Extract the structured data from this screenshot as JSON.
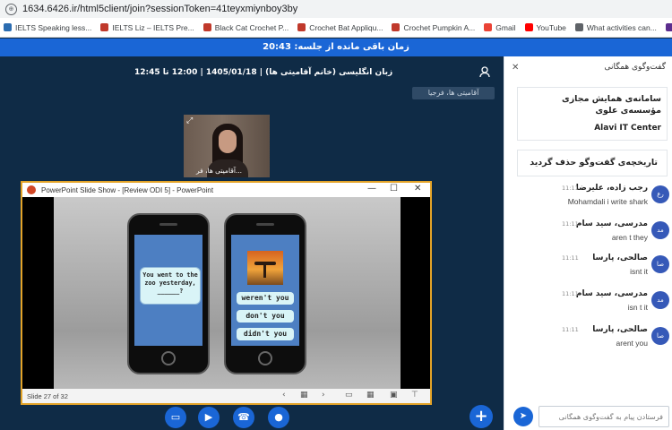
{
  "browser": {
    "url": "1634.6426.ir/html5client/join?sessionToken=41teyxmiynboy3by",
    "bookmarks": [
      {
        "label": "IELTS Speaking less...",
        "icon": "ielts-icon",
        "color": "#2b6cb0"
      },
      {
        "label": "IELTS Liz – IELTS Pre...",
        "icon": "liz-icon",
        "color": "#c0392b"
      },
      {
        "label": "Black Cat Crochet P...",
        "icon": "crochet-icon",
        "color": "#c0392b"
      },
      {
        "label": "Crochet Bat Appliqu...",
        "icon": "crochet-icon",
        "color": "#c0392b"
      },
      {
        "label": "Crochet Pumpkin A...",
        "icon": "crochet-icon",
        "color": "#c0392b"
      },
      {
        "label": "Gmail",
        "icon": "gmail-icon",
        "color": "#ea4335"
      },
      {
        "label": "YouTube",
        "icon": "youtube-icon",
        "color": "#ff0000"
      },
      {
        "label": "What activities can...",
        "icon": "web-icon",
        "color": "#5f6368"
      },
      {
        "label": "Reports - K",
        "icon": "reports-icon",
        "color": "#5b2d8e"
      }
    ]
  },
  "timer": {
    "text": "زمان باقی مانده از جلسه: 20:43"
  },
  "session": {
    "title": "زبان انگلیسی (خانم آقامیتی ها) | 1405/01/18 | 12:00 تا 12:45",
    "presenter_tag": "آقامیتی ها، فرجیا",
    "webcam_name": "آقامیتی ها، فر..."
  },
  "ppt": {
    "window_title": "PowerPoint Slide Show - [Review ODI 5] - PowerPoint",
    "slide_status": "Slide 27 of 32",
    "question": "You went to the zoo yesterday, ______?",
    "answers": [
      "weren't you",
      "don't you",
      "didn't you"
    ]
  },
  "chat": {
    "header": "گفت‌وگوی همگانی",
    "welcome_line1": "سامانه‌ی همایش مجازی مؤسسه‌ی علوی",
    "welcome_line2": "Alavi IT Center",
    "cleared": "تاریخچه‌ی گفت‌وگو حذف گردید",
    "messages": [
      {
        "avatar": "رع",
        "sender": "رجب زاده، علیرضا",
        "time": "11:11",
        "text": "Mohamdali i write shark"
      },
      {
        "avatar": "مد",
        "sender": "مدرسی، سید سام",
        "time": "11:11",
        "text": "aren t they"
      },
      {
        "avatar": "صا",
        "sender": "صالحی، پارسا",
        "time": "11:11",
        "text": "isnt it"
      },
      {
        "avatar": "مد",
        "sender": "مدرسی، سید سام",
        "time": "11:11",
        "text": "isn t it"
      },
      {
        "avatar": "صا",
        "sender": "صالحی، پارسا",
        "time": "11:11",
        "text": "arent you"
      }
    ],
    "input_placeholder": "فرستادن پیام به گفت‌وگوی همگانی"
  },
  "colors": {
    "accent": "#1a66d6",
    "background": "#0f2b46",
    "ppt_border": "#e3a328"
  }
}
